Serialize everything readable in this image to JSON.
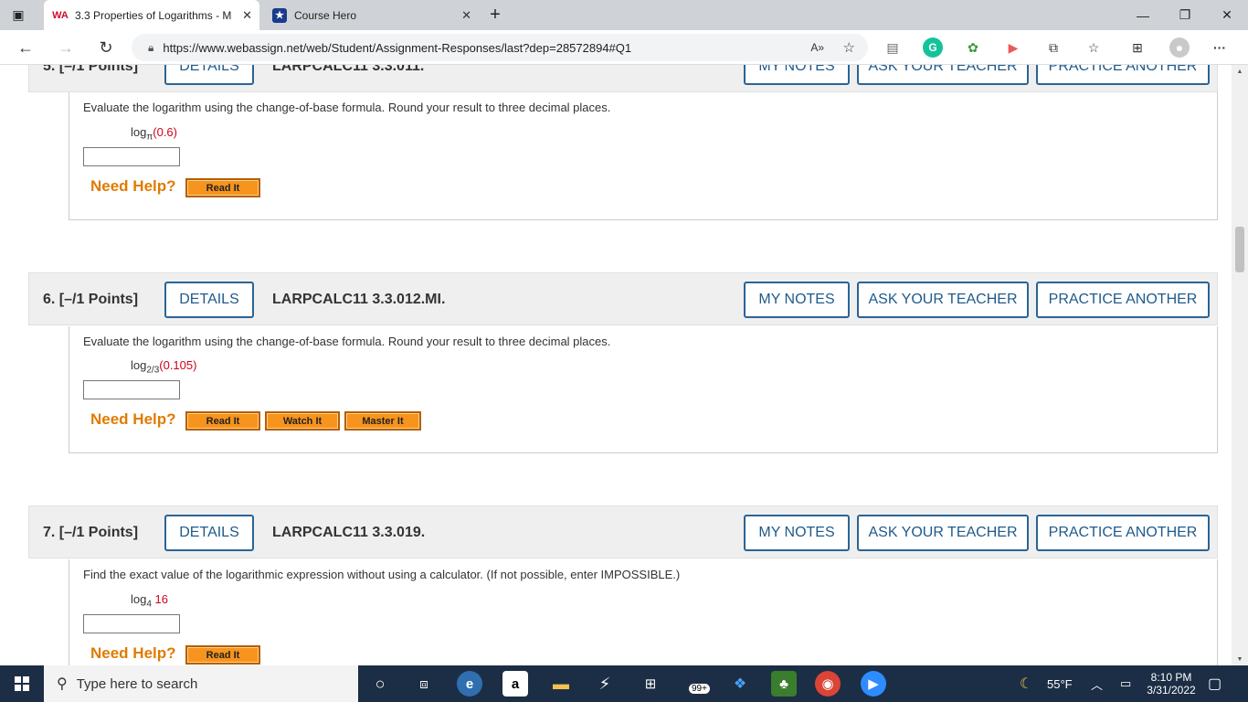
{
  "browser": {
    "tabs": [
      {
        "title": "3.3 Properties of Logarithms - M",
        "favicon": "WA",
        "close": "✕"
      },
      {
        "title": "Course Hero",
        "favicon": "★",
        "close": "✕"
      }
    ],
    "new_tab": "+",
    "url": "https://www.webassign.net/web/Student/Assignment-Responses/last?dep=28572894#Q1",
    "read_aloud": "A»",
    "more": "···"
  },
  "questions": [
    {
      "number": "5. [–/1 Points]",
      "details": "DETAILS",
      "code": "LARPCALC11 3.3.011.",
      "my_notes": "MY NOTES",
      "ask": "ASK YOUR TEACHER",
      "practice": "PRACTICE ANOTHER",
      "prompt": "Evaluate the logarithm using the change-of-base formula. Round your result to three decimal places.",
      "log": "log",
      "base": "π",
      "arg": "(0.6)",
      "help": "Need Help?",
      "buttons": [
        "Read It"
      ]
    },
    {
      "number": "6. [–/1 Points]",
      "details": "DETAILS",
      "code": "LARPCALC11 3.3.012.MI.",
      "my_notes": "MY NOTES",
      "ask": "ASK YOUR TEACHER",
      "practice": "PRACTICE ANOTHER",
      "prompt": "Evaluate the logarithm using the change-of-base formula. Round your result to three decimal places.",
      "log": "log",
      "base": "2/3",
      "arg": "(0.105)",
      "help": "Need Help?",
      "buttons": [
        "Read It",
        "Watch It",
        "Master It"
      ]
    },
    {
      "number": "7. [–/1 Points]",
      "details": "DETAILS",
      "code": "LARPCALC11 3.3.019.",
      "my_notes": "MY NOTES",
      "ask": "ASK YOUR TEACHER",
      "practice": "PRACTICE ANOTHER",
      "prompt": "Find the exact value of the logarithmic expression without using a calculator. (If not possible, enter IMPOSSIBLE.)",
      "log": "log",
      "base": "4",
      "arg": " 16",
      "help": "Need Help?",
      "buttons": [
        "Read It"
      ]
    }
  ],
  "taskbar": {
    "search_placeholder": "Type here to search",
    "badge": "99+",
    "weather": "55°F",
    "time": "8:10 PM",
    "date": "3/31/2022"
  },
  "colors": {
    "accent": "#1f5a8b",
    "help": "#e07b00",
    "orange_button": "#f7941d",
    "math_red": "#d0021b"
  }
}
